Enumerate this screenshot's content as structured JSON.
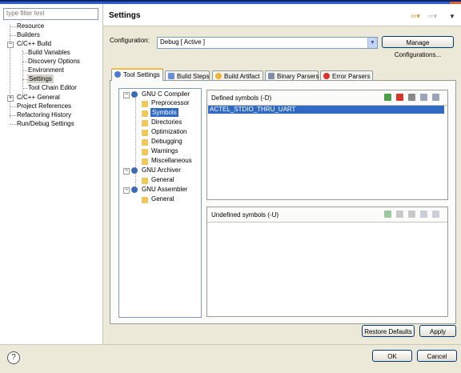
{
  "filter": {
    "placeholder": "type filter text"
  },
  "left_tree": [
    {
      "label": "Resource",
      "selected": false
    },
    {
      "label": "Builders",
      "selected": false
    },
    {
      "label": "C/C++ Build",
      "selected": false
    },
    {
      "label": "Build Variables",
      "selected": false
    },
    {
      "label": "Discovery Options",
      "selected": false
    },
    {
      "label": "Environment",
      "selected": false
    },
    {
      "label": "Settings",
      "selected": true
    },
    {
      "label": "Tool Chain Editor",
      "selected": false
    },
    {
      "label": "C/C++ General",
      "selected": false
    },
    {
      "label": "Project References",
      "selected": false
    },
    {
      "label": "Refactoring History",
      "selected": false
    },
    {
      "label": "Run/Debug Settings",
      "selected": false
    }
  ],
  "header": {
    "title": "Settings"
  },
  "configuration": {
    "label": "Configuration:",
    "value": "Debug  [ Active ]",
    "manage_button": "Manage Configurations..."
  },
  "tabs": [
    {
      "label": "Tool Settings",
      "icon": "tool-settings-icon",
      "active": true,
      "color": "#4a7bd0"
    },
    {
      "label": "Build Steps",
      "icon": "build-steps-icon",
      "active": false,
      "color": "#6b8fd6"
    },
    {
      "label": "Build Artifact",
      "icon": "build-artifact-icon",
      "active": false,
      "color": "#f2b632"
    },
    {
      "label": "Binary Parsers",
      "icon": "binary-parsers-icon",
      "active": false,
      "color": "#7d8fa8"
    },
    {
      "label": "Error Parsers",
      "icon": "error-parsers-icon",
      "active": false,
      "color": "#d9342b"
    }
  ],
  "tool_tree": {
    "gnu_c_compiler": "GNU C Compiler",
    "preprocessor": "Preprocessor",
    "symbols": "Symbols",
    "directories": "Directories",
    "optimization": "Optimization",
    "debugging": "Debugging",
    "warnings": "Warnings",
    "miscellaneous": "Miscellaneous",
    "gnu_archiver": "GNU Archiver",
    "archiver_general": "General",
    "gnu_assembler": "GNU Assembler",
    "assembler_general": "General"
  },
  "defined_symbols": {
    "title": "Defined symbols (-D)",
    "items": [
      "ACTEL_STDIO_THRU_UART"
    ]
  },
  "undefined_symbols": {
    "title": "Undefined symbols (-U)"
  },
  "buttons": {
    "restore_defaults": "Restore Defaults",
    "apply": "Apply",
    "ok": "OK",
    "cancel": "Cancel",
    "help": "?"
  },
  "colors": {
    "selection": "#316ac5",
    "accent_tab": "#f8b93c"
  }
}
